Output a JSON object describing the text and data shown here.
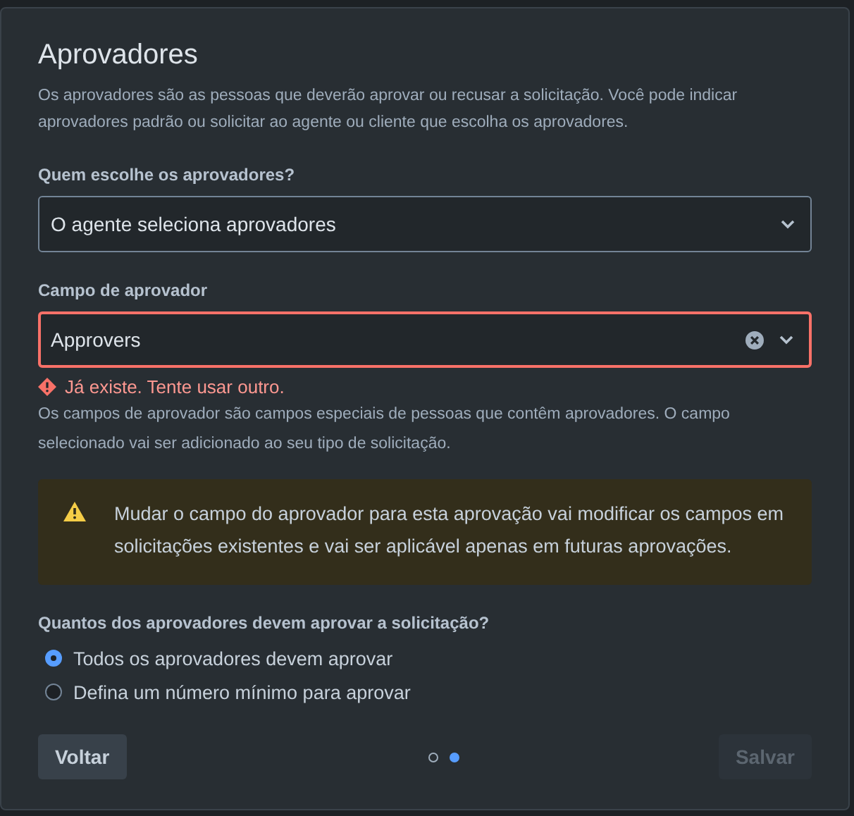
{
  "dialog": {
    "title": "Aprovadores",
    "description": "Os aprovadores são as pessoas que deverão aprovar ou recusar a solicitação. Você pode indicar aprovadores padrão ou solicitar ao agente ou cliente que escolha os aprovadores.",
    "fields": [
      {
        "label": "Quem escolhe os aprovadores?",
        "value": "O agente seleciona aprovadores",
        "invalid": false,
        "clearable": false
      },
      {
        "label": "Campo de aprovador",
        "value": "Approvers",
        "invalid": true,
        "clearable": true,
        "error": "Já existe. Tente usar outro.",
        "help": "Os campos de aprovador são campos especiais de pessoas que contêm aprovadores. O campo selecionado vai ser adicionado ao seu tipo de solicitação."
      }
    ],
    "warning": "Mudar o campo do aprovador para esta aprovação vai modificar os campos em solicitações existentes e vai ser aplicável apenas em futuras aprovações.",
    "question": "Quantos dos aprovadores devem aprovar a solicitação?",
    "options": [
      {
        "label": "Todos os aprovadores devem aprovar",
        "selected": true
      },
      {
        "label": "Defina um número mínimo para aprovar",
        "selected": false
      }
    ],
    "back_button": {
      "label": "Voltar"
    },
    "pages": [
      {
        "selected": false
      },
      {
        "selected": true
      }
    ],
    "save_button": {
      "label": "Salvar",
      "disabled": true
    }
  }
}
